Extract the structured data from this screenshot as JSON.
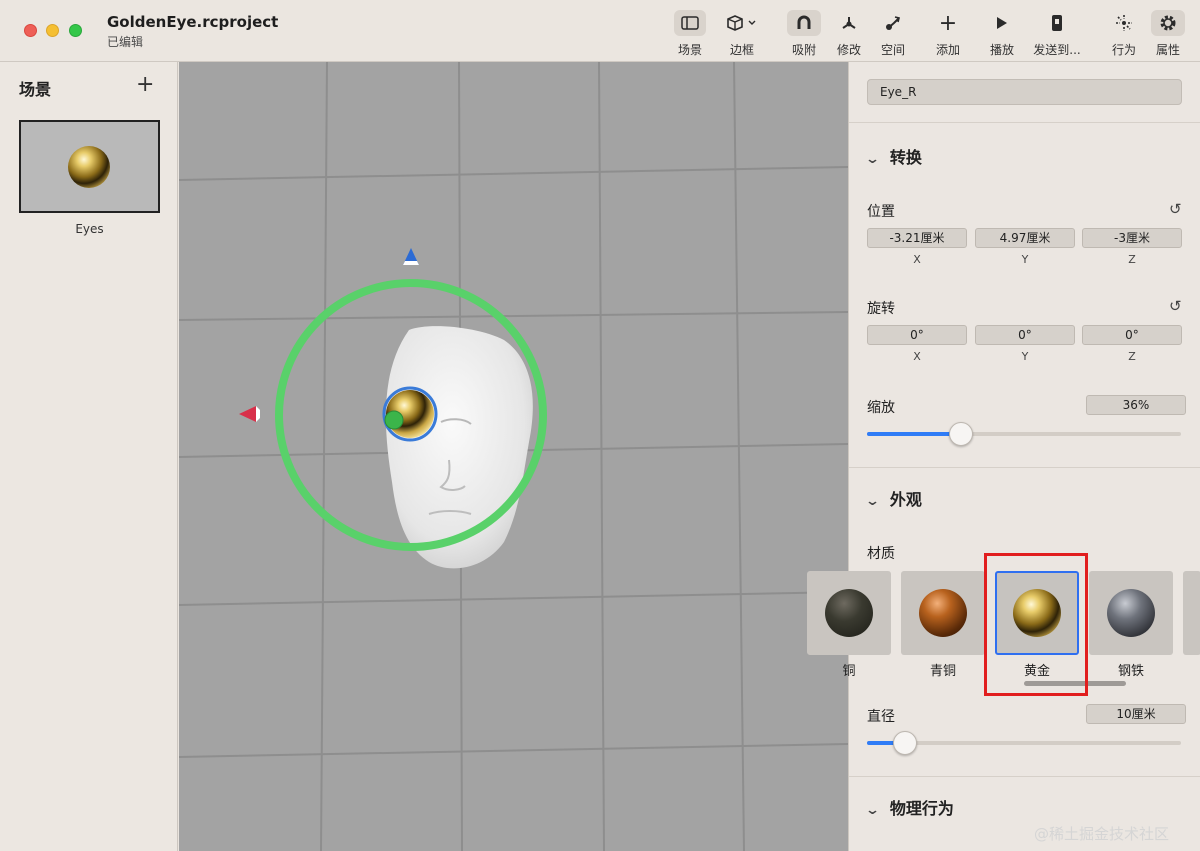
{
  "window": {
    "title": "GoldenEye.rcproject",
    "subtitle": "已编辑"
  },
  "toolbar": {
    "scene": "场景",
    "bounds": "边框",
    "snap": "吸附",
    "modify": "修改",
    "space": "空间",
    "add": "添加",
    "play": "播放",
    "send_to": "发送到...",
    "behaviors": "行为",
    "properties": "属性"
  },
  "scene_panel": {
    "title": "场景",
    "add_symbol": "+",
    "scene_name": "Eyes"
  },
  "inspector": {
    "object_name": "Eye_R",
    "transform": {
      "title": "转换",
      "position": {
        "label": "位置",
        "x": "-3.21厘米",
        "y": "4.97厘米",
        "z": "-3厘米"
      },
      "rotation": {
        "label": "旋转",
        "x": "0°",
        "y": "0°",
        "z": "0°"
      },
      "axes": {
        "x": "X",
        "y": "Y",
        "z": "Z"
      },
      "scale": {
        "label": "缩放",
        "value": "36%",
        "fraction": 0.3
      }
    },
    "appearance": {
      "title": "外观",
      "material_label": "材质",
      "materials": [
        {
          "name": "铜",
          "icon": "copper-sphere"
        },
        {
          "name": "青铜",
          "icon": "bronze-sphere"
        },
        {
          "name": "黄金",
          "icon": "gold-sphere",
          "selected": true
        },
        {
          "name": "钢铁",
          "icon": "steel-sphere"
        }
      ],
      "diameter": {
        "label": "直径",
        "value": "10厘米",
        "fraction": 0.12
      }
    },
    "physics": {
      "title": "物理行为"
    }
  },
  "watermark": "@稀土掘金技术社区",
  "colors": {
    "accent": "#2f7cf6",
    "selection_ring": "#59d16a",
    "highlight_box": "#e11e1e"
  }
}
